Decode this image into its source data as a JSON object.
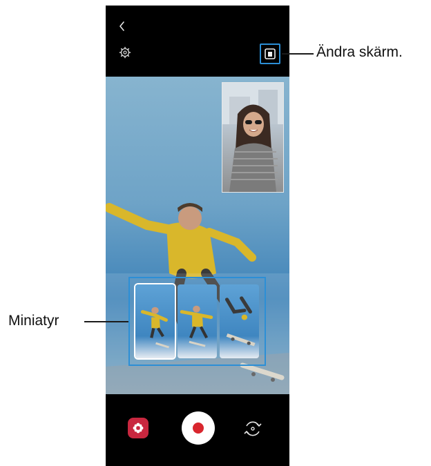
{
  "callouts": {
    "change_screen": "Ändra skärm.",
    "thumbnail": "Miniatyr"
  },
  "icons": {
    "back": "chevron-left-icon",
    "settings": "gear-icon",
    "change_screen": "change-screen-icon",
    "gallery": "gallery-icon",
    "record": "record-icon",
    "switch_camera": "switch-camera-icon"
  },
  "colors": {
    "highlight": "#2c8fd6",
    "record": "#d9262e",
    "gallery": "#c8273f"
  }
}
